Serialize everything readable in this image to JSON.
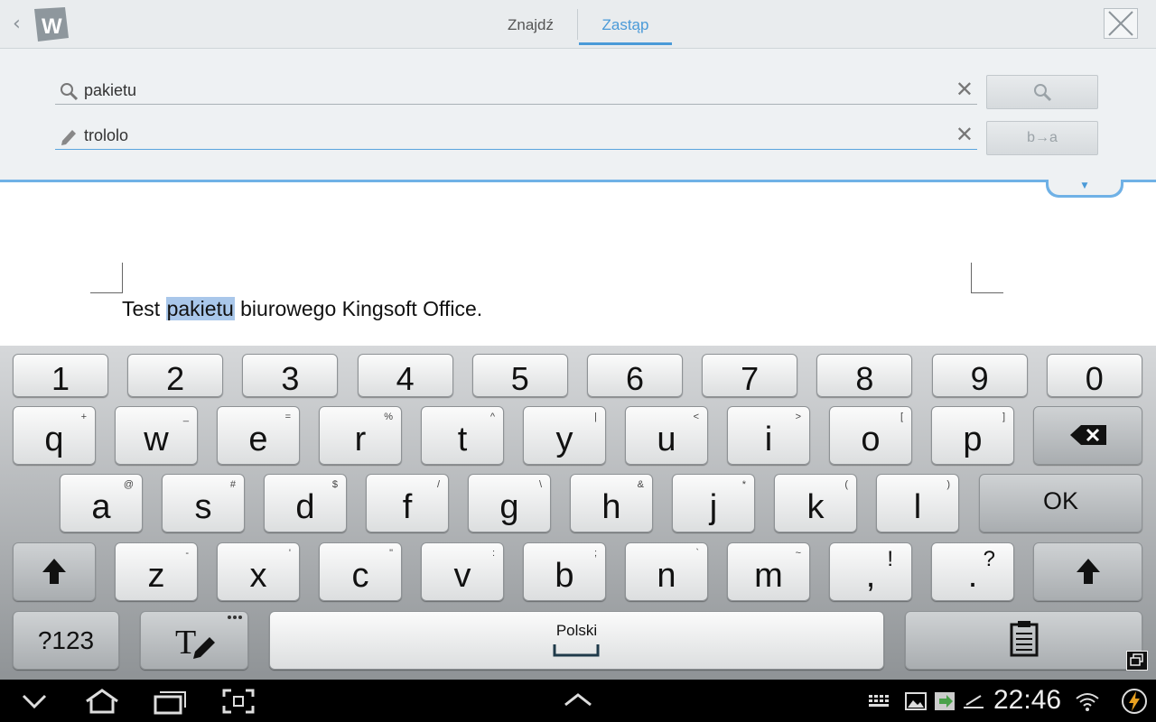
{
  "header": {
    "tabs": [
      {
        "label": "Znajdź",
        "active": false
      },
      {
        "label": "Zastąp",
        "active": true
      }
    ],
    "logo_letter": "W"
  },
  "search_panel": {
    "find_value": "pakietu",
    "replace_value": "trololo",
    "replace_button_label": "b→a"
  },
  "document": {
    "before": "Test ",
    "highlight": "pakietu",
    "after": " biurowego Kingsoft Office."
  },
  "keyboard": {
    "number_row": [
      "1",
      "2",
      "3",
      "4",
      "5",
      "6",
      "7",
      "8",
      "9",
      "0"
    ],
    "row1": [
      {
        "key": "q",
        "hint": "+"
      },
      {
        "key": "w",
        "hint": "_"
      },
      {
        "key": "e",
        "hint": "="
      },
      {
        "key": "r",
        "hint": "%"
      },
      {
        "key": "t",
        "hint": "^"
      },
      {
        "key": "y",
        "hint": "|"
      },
      {
        "key": "u",
        "hint": "<"
      },
      {
        "key": "i",
        "hint": ">"
      },
      {
        "key": "o",
        "hint": "["
      },
      {
        "key": "p",
        "hint": "]"
      }
    ],
    "row2": [
      {
        "key": "a",
        "hint": "@"
      },
      {
        "key": "s",
        "hint": "#"
      },
      {
        "key": "d",
        "hint": "$"
      },
      {
        "key": "f",
        "hint": "/"
      },
      {
        "key": "g",
        "hint": "\\"
      },
      {
        "key": "h",
        "hint": "&"
      },
      {
        "key": "j",
        "hint": "*"
      },
      {
        "key": "k",
        "hint": "("
      },
      {
        "key": "l",
        "hint": ")"
      }
    ],
    "row3": [
      {
        "key": "z",
        "hint": "-"
      },
      {
        "key": "x",
        "hint": "'"
      },
      {
        "key": "c",
        "hint": "\""
      },
      {
        "key": "v",
        "hint": ":"
      },
      {
        "key": "b",
        "hint": ";"
      },
      {
        "key": "n",
        "hint": "`"
      },
      {
        "key": "m",
        "hint": "~"
      },
      {
        "key": ",",
        "hint": "!"
      },
      {
        "key": ".",
        "hint": "?"
      }
    ],
    "ok_label": "OK",
    "symbols_label": "?123",
    "language_label": "Polski"
  },
  "status_bar": {
    "time": "22:46"
  },
  "colors": {
    "accent": "#4a9ad8",
    "highlight": "#a9c7ea"
  }
}
